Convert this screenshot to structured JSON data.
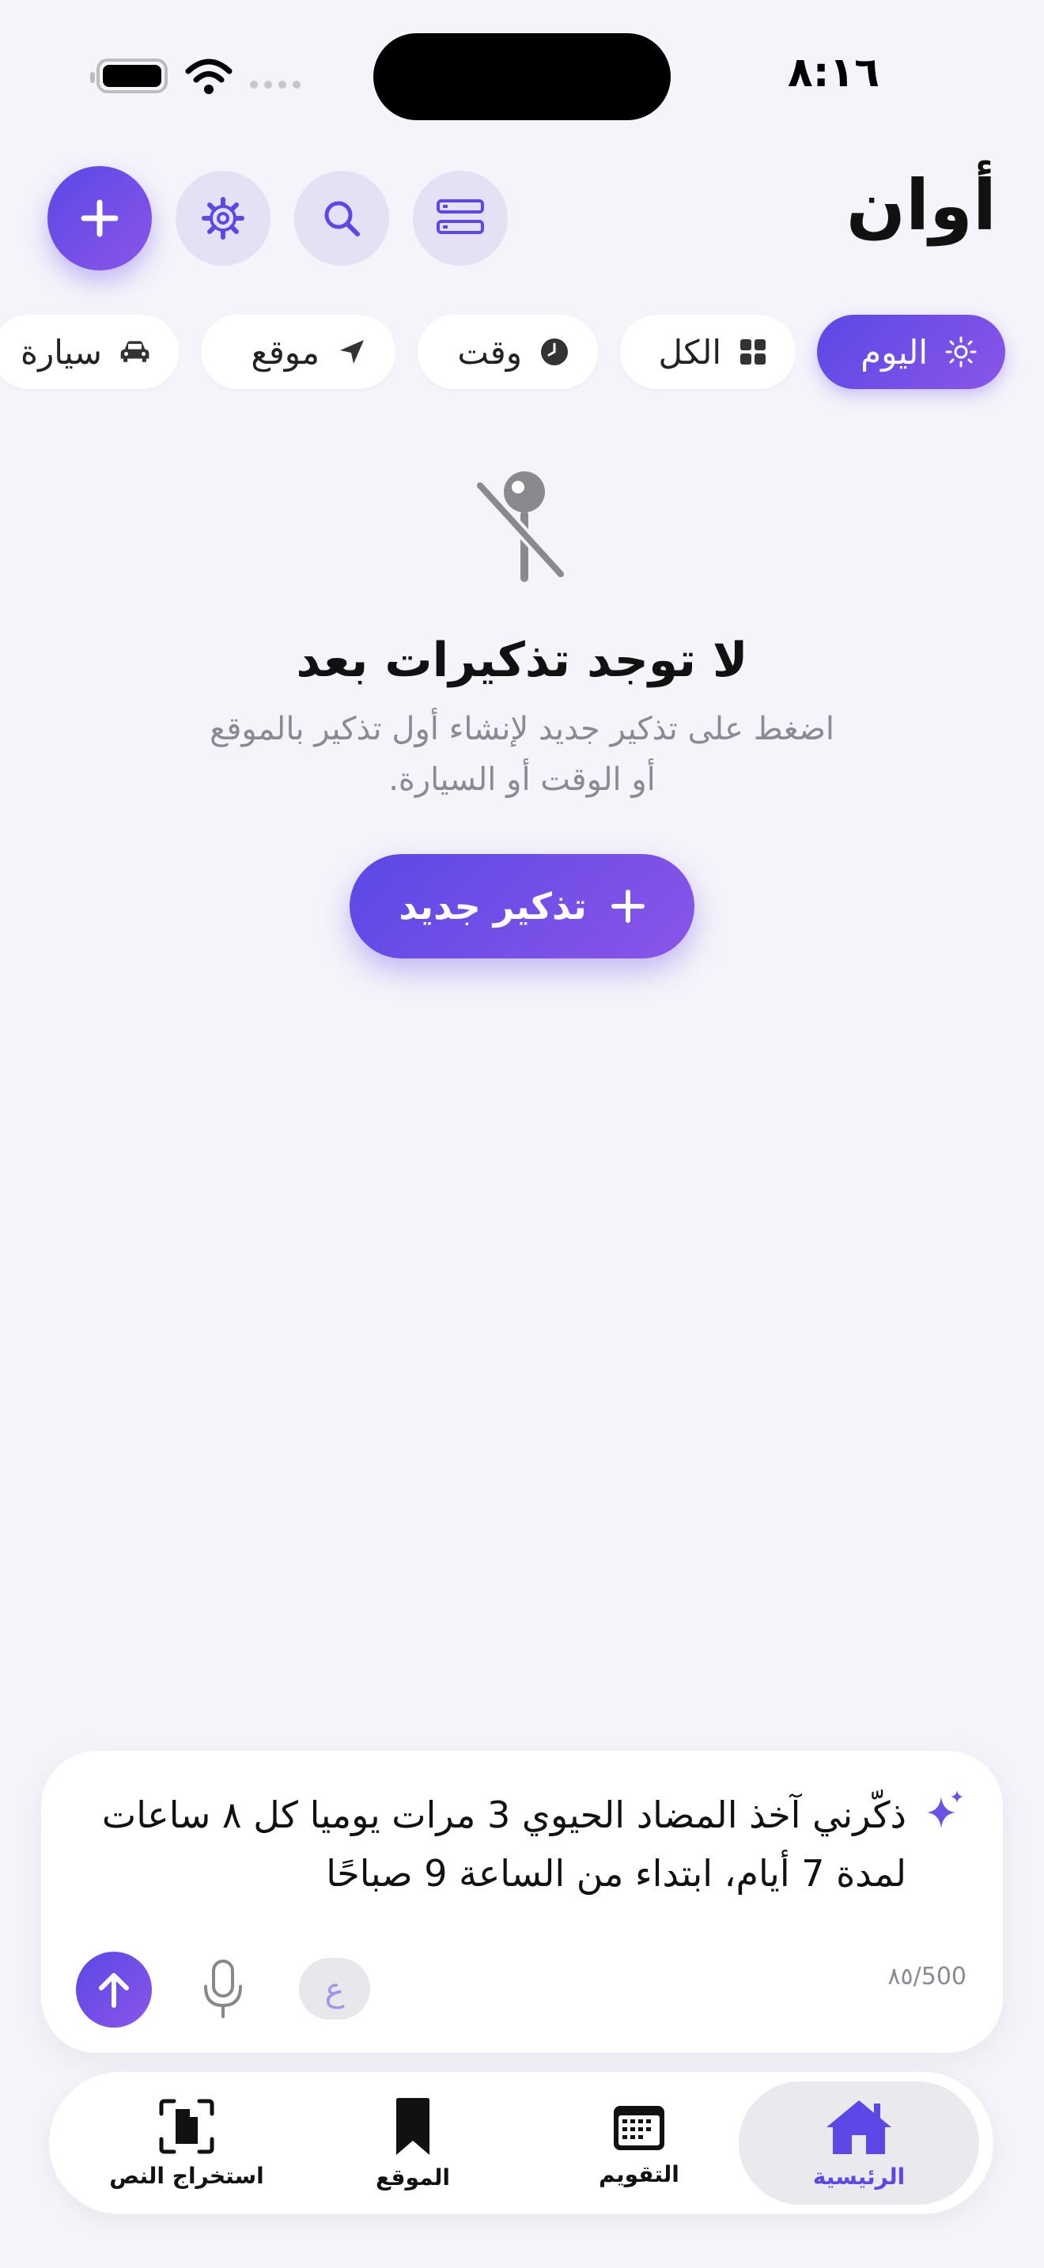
{
  "status": {
    "time": "٨:١٦"
  },
  "header": {
    "title": "أوان"
  },
  "filters": {
    "today": "اليوم",
    "all": "الكل",
    "time": "وقت",
    "location": "موقع",
    "car": "سيارة"
  },
  "empty_state": {
    "title": "لا توجد تذكيرات بعد",
    "subtitle": "اضغط على تذكير جديد لإنشاء أول تذكير بالموقع أو الوقت أو السيارة.",
    "button_label": "تذكير جديد"
  },
  "composer": {
    "text": "ذكّرني آخذ المضاد الحيوي 3 مرات يوميا كل ٨ ساعات لمدة 7 أيام، ابتداء من الساعة 9 صباحًا",
    "counter": "٨٥/500",
    "lang_label": "ع"
  },
  "tabbar": {
    "home": "الرئيسية",
    "calendar": "التقويم",
    "location": "الموقع",
    "extract": "استخراج النص"
  },
  "colors": {
    "accent": "#5b48e6",
    "accent_end": "#8a55e8"
  }
}
